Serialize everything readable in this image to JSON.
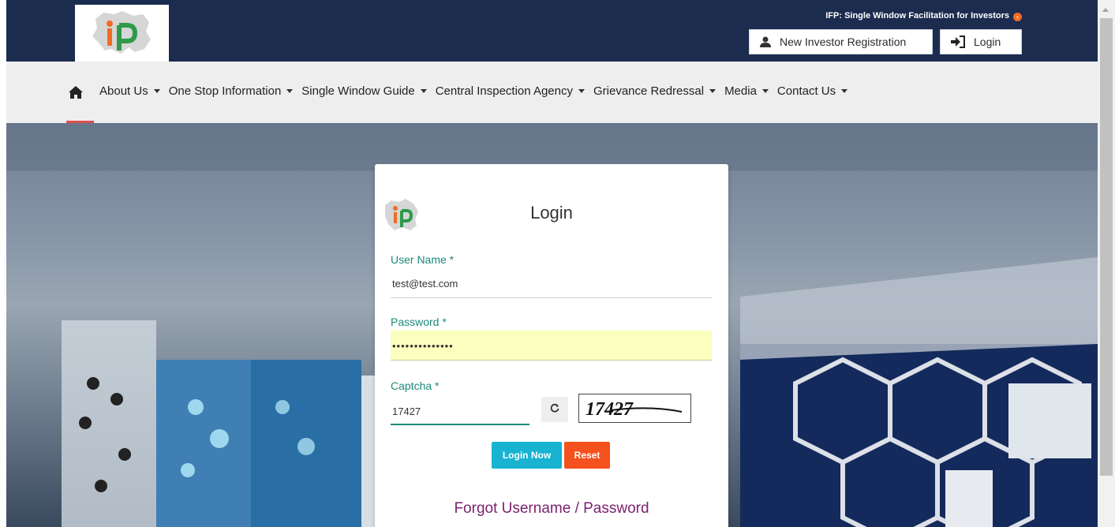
{
  "header": {
    "tagline": "IFP: Single Window Facilitation for Investors",
    "register_button": "New Investor Registration",
    "login_button": "Login",
    "bg_color": "#1c2c4f"
  },
  "nav": {
    "items": [
      {
        "label": "About Us"
      },
      {
        "label": "One Stop Information"
      },
      {
        "label": "Single Window Guide"
      },
      {
        "label": "Central Inspection Agency"
      },
      {
        "label": "Grievance Redressal"
      },
      {
        "label": "Media"
      },
      {
        "label": "Contact Us"
      }
    ]
  },
  "login": {
    "title": "Login",
    "username_label": "User Name *",
    "username_value": "test@test.com",
    "password_label": "Password *",
    "password_value": "••••••••••••••",
    "captcha_label": "Captcha *",
    "captcha_value": "17427",
    "captcha_image_text": "17427",
    "login_button": "Login Now",
    "reset_button": "Reset",
    "forgot_link": "Forgot Username / Password"
  },
  "colors": {
    "accent_teal": "#1b8a7a",
    "login_btn": "#17b3d0",
    "reset_btn": "#f4511e",
    "forgot_link": "#7b1f6e"
  }
}
